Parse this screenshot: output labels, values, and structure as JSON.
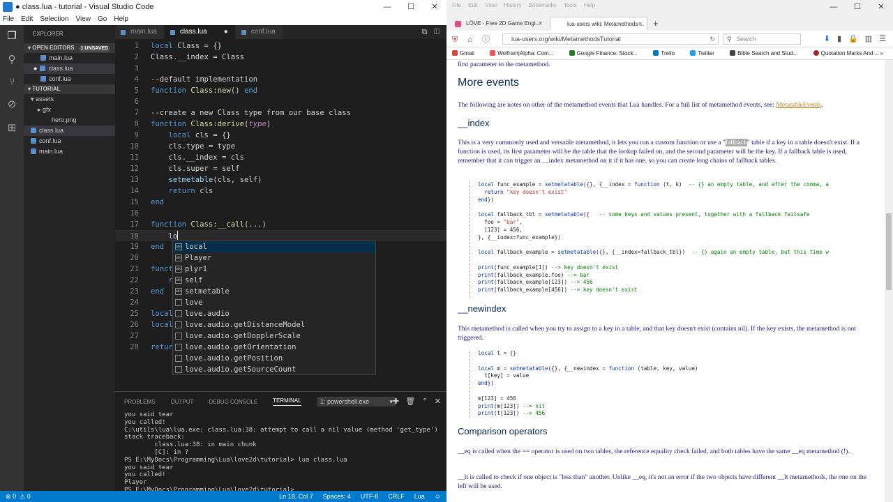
{
  "vscode": {
    "title": "● class.lua - tutorial - Visual Studio Code",
    "menu": [
      "File",
      "Edit",
      "Selection",
      "View",
      "Go",
      "Help"
    ],
    "explorer": {
      "title": "EXPLORER",
      "open_editors_label": "OPEN EDITORS",
      "unsaved_badge": "1 UNSAVED",
      "open_files": [
        "main.lua",
        "class.lua",
        "conf.lua"
      ],
      "tutorial_label": "TUTORIAL",
      "tree": [
        "assets",
        "gfx",
        "hero.png",
        "class.lua",
        "conf.lua",
        "main.lua"
      ]
    },
    "tabs": [
      "main.lua",
      "class.lua",
      "conf.lua"
    ],
    "code_lines": [
      "1",
      "2",
      "3",
      "4",
      "5",
      "6",
      "7",
      "8",
      "9",
      "10",
      "11",
      "12",
      "13",
      "14",
      "15",
      "16",
      "17",
      "18",
      "19",
      "20",
      "21",
      "22",
      "23",
      "24",
      "25",
      "26",
      "27",
      "28"
    ],
    "suggestions": [
      "local",
      "Player",
      "plyr1",
      "self",
      "setmetable",
      "love",
      "love.audio",
      "love.audio.getDistanceModel",
      "love.audio.getDopplerScale",
      "love.audio.getOrientation",
      "love.audio.getPosition",
      "love.audio.getSourceCount"
    ],
    "panel_tabs": [
      "PROBLEMS",
      "OUTPUT",
      "DEBUG CONSOLE",
      "TERMINAL"
    ],
    "terminal_select": "1: powershell.exe",
    "terminal_lines": [
      "you said tear",
      "you called!",
      "C:\\utils\\lua\\lua.exe: class.lua:38: attempt to call a nil value (method 'get_type')",
      "stack traceback:",
      "        class.lua:38: in main chunk",
      "        [C]: in ?",
      "PS E:\\MyDocs\\Programming\\Lua\\love2d\\tutorial> lua class.lua",
      "you said tear",
      "you called!",
      "Player",
      "PS E:\\MyDocs\\Programming\\Lua\\love2d\\tutorial> "
    ],
    "status": {
      "errors": "0",
      "warnings": "0",
      "position": "Ln 18, Col 7",
      "spaces": "Spaces: 4",
      "encoding": "UTF-8",
      "eol": "CRLF",
      "language": "Lua"
    }
  },
  "firefox": {
    "menu": [
      "File",
      "Edit",
      "View",
      "History",
      "Bookmarks",
      "Tools",
      "Help"
    ],
    "tabs": [
      "LÖVE - Free 2D Game Engi...",
      "lua-users wiki: Metamethods ..."
    ],
    "url": "lua-users.org/wiki/MetamethodsTutorial",
    "search_placeholder": "Search",
    "bookmarks": [
      "Gmail",
      "Wolfram|Alpha: Com...",
      "Google Finance: Stock...",
      "Trello",
      "Twitter",
      "Bible Search and Stud...",
      "Quotation Marks And ..."
    ],
    "content": {
      "top_text": "first parameter to the metamethod.",
      "h_more": "More events",
      "p_more_1": "The following are notes on other of the metamethod events that Lua handles. For a full list of metamethod events, see: ",
      "p_more_link": "MetatableEvents",
      "h_index": "__index",
      "p_index_1": "This is a very commonly used and versatile metamethod, it lets you run a custom function or use a \"",
      "p_index_hl": "fallback",
      "p_index_2": "\" table if a key in a table doesn't exist. If a function is used, its first parameter will be the table that the lookup failed on, and the second parameter will be the key. If a fallback table is used, remember that it can trigger an __index metamethod on it if it has one, so you can create long chains of fallback tables.",
      "h_newindex": "__newindex",
      "p_newindex": "This metamethod is called when you try to assign to a key in a table, and that key doesn't exist (contains nil). If the key exists, the metamethod is not triggered.",
      "h_compare": "Comparison operators",
      "p_eq": "__eq is called when the == operator is used on two tables, the reference equality check failed, and both tables have the same __eq metamethod (!).",
      "p_lt": "__lt is called to check if one object is \"less than\" another. Unlike __eq, it's not an error if the two objects have different __lt metamethods, the one on the left will be used."
    }
  }
}
